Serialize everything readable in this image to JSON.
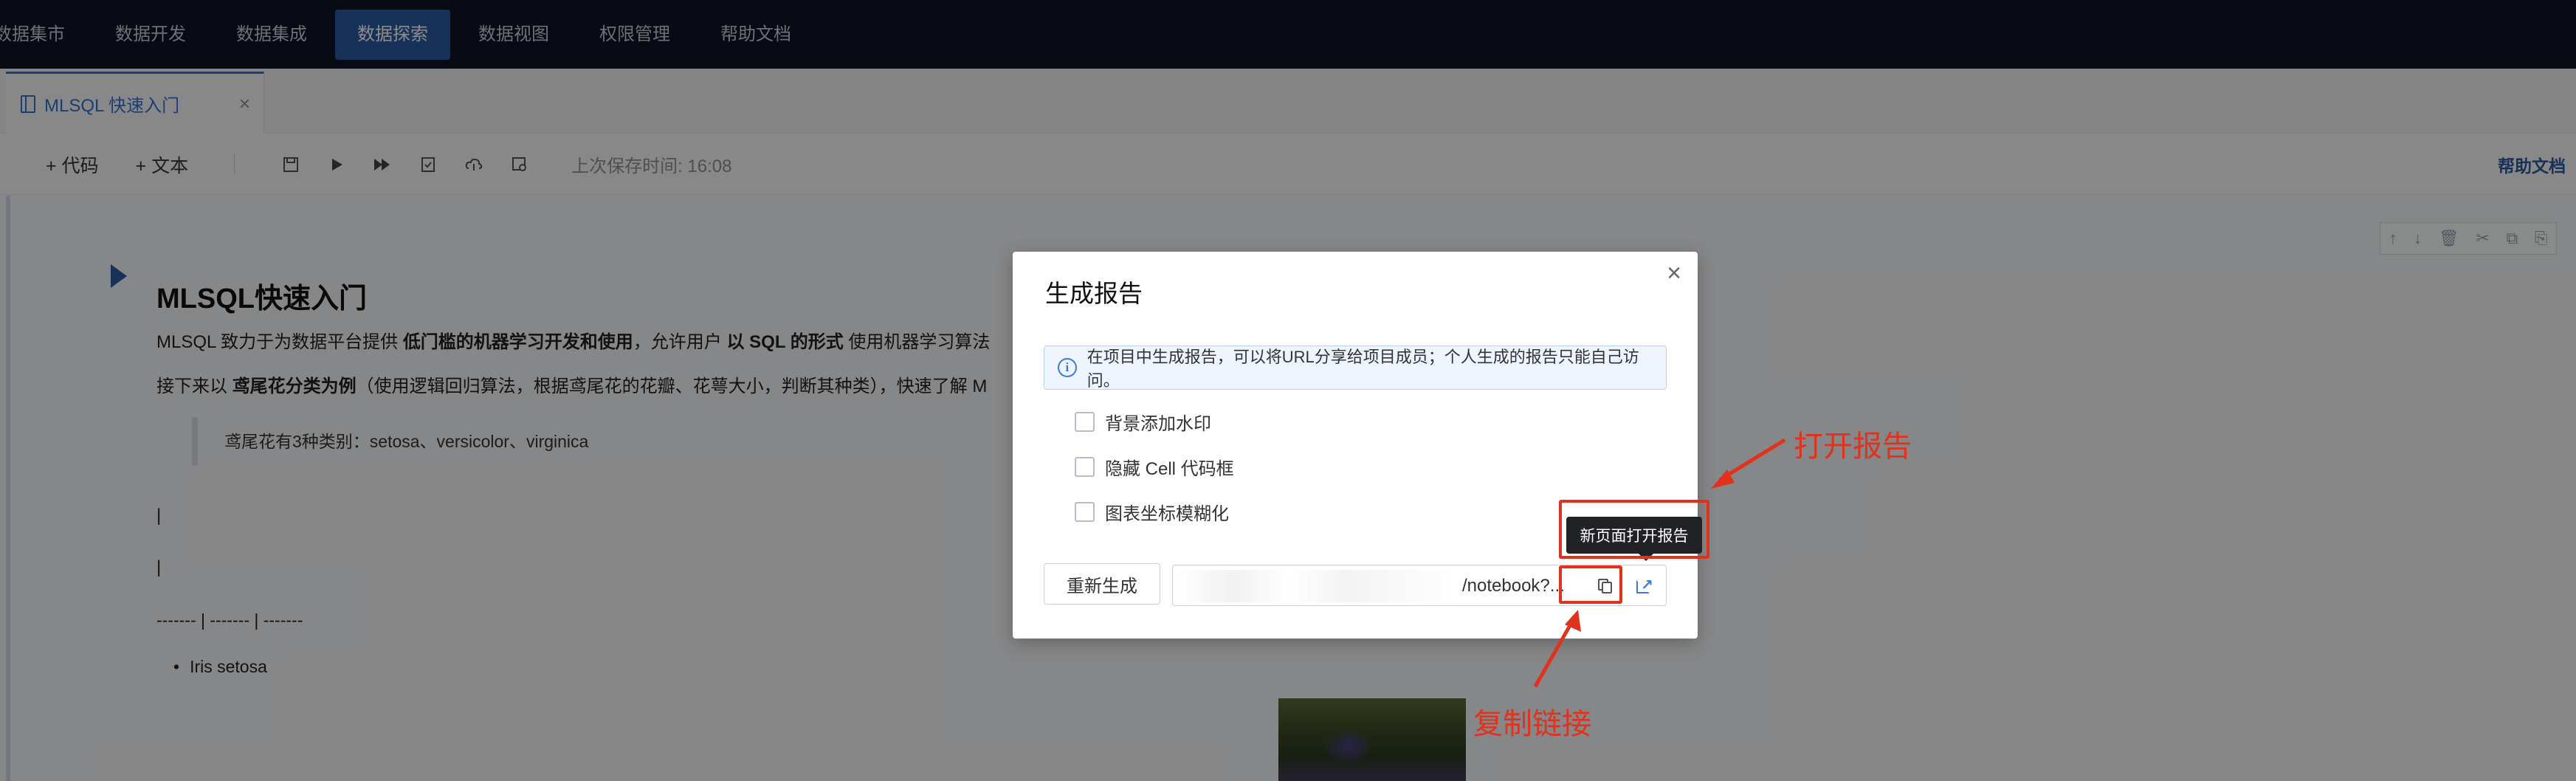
{
  "nav": {
    "items": [
      {
        "label": "数据集市",
        "active": false
      },
      {
        "label": "数据开发",
        "active": false
      },
      {
        "label": "数据集成",
        "active": false
      },
      {
        "label": "数据探索",
        "active": true
      },
      {
        "label": "数据视图",
        "active": false
      },
      {
        "label": "权限管理",
        "active": false
      },
      {
        "label": "帮助文档",
        "active": false
      }
    ]
  },
  "tab": {
    "label": "MLSQL 快速入门",
    "close": "×"
  },
  "toolbar": {
    "add_code": "+ 代码",
    "add_text": "+ 文本",
    "saved_time": "上次保存时间: 16:08",
    "help": "帮助文档"
  },
  "notebook": {
    "title": "MLSQL快速入门",
    "p1_a": "MLSQL 致力于为数据平台提供 ",
    "p1_b": "低门槛的机器学习开发和使用",
    "p1_c": "，允许用户 ",
    "p1_d": "以 SQL 的形式",
    "p1_e": " 使用机器学习算法",
    "p2_a": "接下来以 ",
    "p2_b": "鸢尾花分类为例",
    "p2_c": "（使用逻辑回归算法，根据鸢尾花的花瓣、花萼大小，判断其种类），快速了解 M",
    "quote": "鸢尾花有3种类别：setosa、versicolor、virginica",
    "pipe1": "|",
    "pipe2": "|",
    "table_sep": "------- | ------- | -------",
    "list_item": "Iris setosa"
  },
  "modal": {
    "title": "生成报告",
    "close": "×",
    "info": "在项目中生成报告，可以将URL分享给项目成员；个人生成的报告只能自己访问。",
    "options": [
      {
        "label": "背景添加水印",
        "checked": false
      },
      {
        "label": "隐藏 Cell 代码框",
        "checked": false
      },
      {
        "label": "图表坐标模糊化",
        "checked": false
      }
    ],
    "regenerate": "重新生成",
    "link_visible": "/notebook?..."
  },
  "tooltip": "新页面打开报告",
  "annotations": {
    "open_report": "打开报告",
    "copy_link": "复制链接",
    "color": "#e0321c"
  }
}
